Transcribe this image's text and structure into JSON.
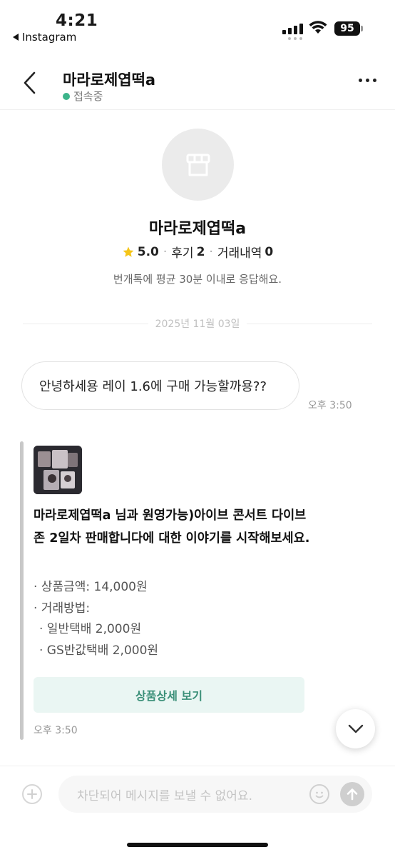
{
  "status_bar": {
    "time": "4:21",
    "back_app": "Instagram",
    "battery": "95"
  },
  "header": {
    "title": "마라로제엽떡a",
    "status": "접속중",
    "status_color": "#3cb48a"
  },
  "profile": {
    "name": "마라로제엽떡a",
    "rating": "5.0",
    "reviews_label": "후기",
    "reviews_count": "2",
    "trades_label": "거래내역",
    "trades_count": "0",
    "response_note": "번개톡에 평균 30분 이내로 응답해요.",
    "icon": "store-icon"
  },
  "chat": {
    "date": "2025년 11월 03일",
    "messages": [
      {
        "text": "안녕하세용 레이 1.6에 구매 가능할까용??",
        "time": "오후 3:50"
      }
    ]
  },
  "product_card": {
    "title": "마라로제엽떡a 님과 원영가능)아이브 콘서트 다이브존 2일차 판매합니다에 대한 이야기를 시작해보세요.",
    "details": [
      "· 상품금액: 14,000원",
      "· 거래방법:",
      "· 일반택배 2,000원",
      "· GS반값택배 2,000원"
    ],
    "detail_button": "상품상세 보기",
    "time": "오후 3:50",
    "accent_color": "#3a8f78"
  },
  "input": {
    "placeholder": "차단되어 메시지를 보낼 수 없어요."
  }
}
